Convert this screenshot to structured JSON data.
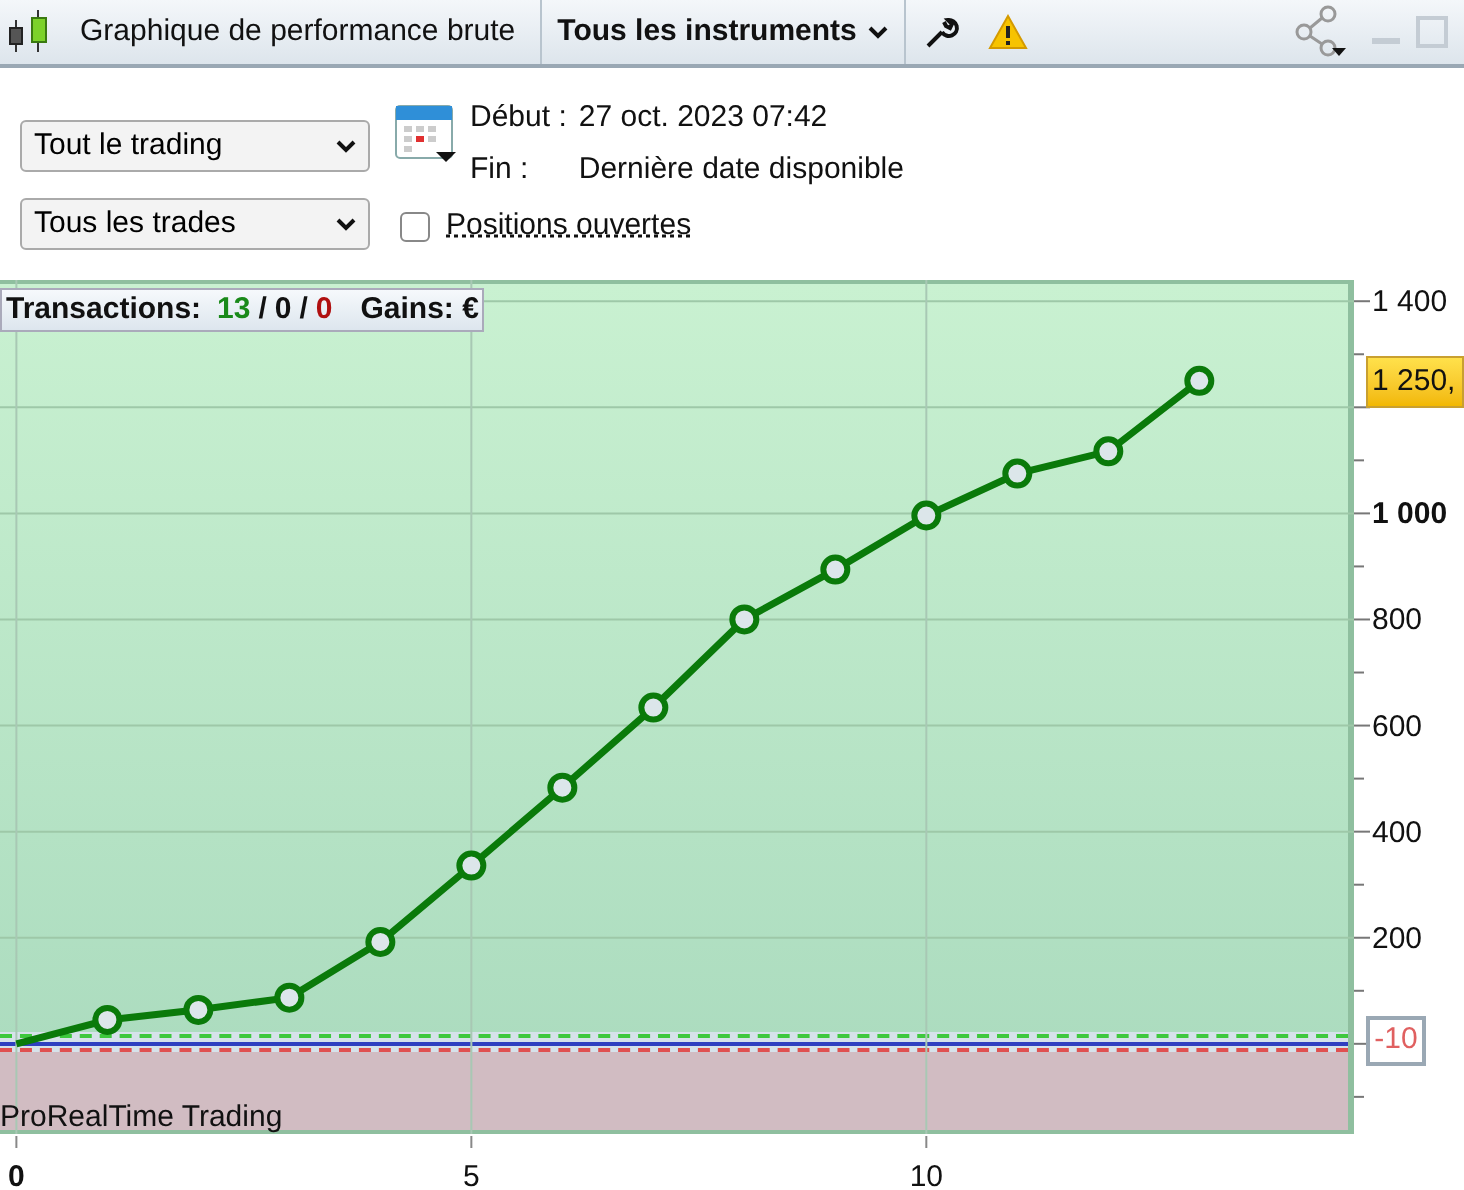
{
  "toolbar": {
    "title": "Graphique de performance brute",
    "instruments_menu": "Tous les instruments"
  },
  "filters": {
    "period_select": "Tout le trading",
    "trades_select": "Tous les trades",
    "start_label": "Début :",
    "start_value": "27 oct. 2023 07:42",
    "end_label": "Fin :",
    "end_value": "Dernière date disponible",
    "open_positions": {
      "label": "Positions ouvertes",
      "checked": false
    }
  },
  "chart": {
    "summary": {
      "label": "Transactions:",
      "winning": "13",
      "sep1": "/",
      "neutral": "0",
      "sep2": "/",
      "losing": "0",
      "gains_label": "Gains: €"
    },
    "brand": "ProRealTime Trading",
    "last_value_tag": "1 250,",
    "reference_tag": "-10",
    "chart_data": {
      "type": "line",
      "x": [
        0,
        1,
        2,
        3,
        4,
        5,
        6,
        7,
        8,
        9,
        10,
        11,
        12,
        13
      ],
      "series": [
        {
          "color": "#0a7a0a",
          "marker": "o",
          "values": [
            0,
            45,
            64,
            87,
            192,
            336,
            483,
            634,
            800,
            894,
            996,
            1075,
            1117,
            1250
          ]
        }
      ],
      "grid": true,
      "xlim": [
        -0.18,
        14.7
      ],
      "ylim": [
        -170,
        1440
      ],
      "xticks": [
        0,
        5,
        10
      ],
      "yticks": [
        {
          "value": 200,
          "label": "200"
        },
        {
          "value": 400,
          "label": "400"
        },
        {
          "value": 600,
          "label": "600"
        },
        {
          "value": 800,
          "label": "800"
        },
        {
          "value": 1000,
          "label": "1 000"
        },
        {
          "value": 1400,
          "label": "1 400"
        }
      ]
    }
  }
}
